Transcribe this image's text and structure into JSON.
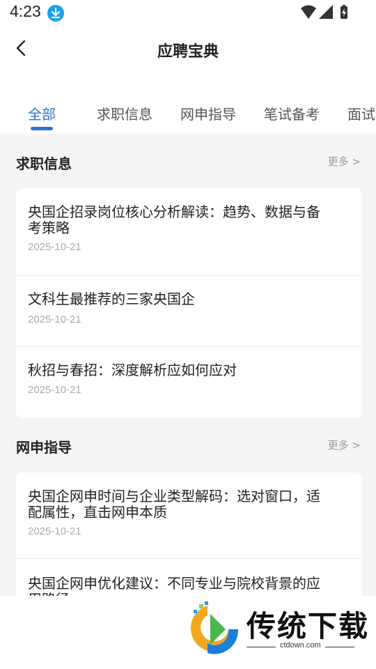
{
  "status_bar": {
    "time": "4:23"
  },
  "header": {
    "title": "应聘宝典"
  },
  "tabs": [
    {
      "label": "全部"
    },
    {
      "label": "求职信息"
    },
    {
      "label": "网申指导"
    },
    {
      "label": "笔试备考"
    },
    {
      "label": "面试"
    }
  ],
  "sections": [
    {
      "title": "求职信息",
      "more": "更多 >",
      "items": [
        {
          "title": "央国企招录岗位核心分析解读：趋势、数据与备考策略",
          "date": "2025-10-21"
        },
        {
          "title": "文科生最推荐的三家央国企",
          "date": "2025-10-21"
        },
        {
          "title": "秋招与春招：深度解析应如何应对",
          "date": "2025-10-21"
        }
      ]
    },
    {
      "title": "网申指导",
      "more": "更多 >",
      "items": [
        {
          "title": "央国企网申时间与企业类型解码：选对窗口，适配属性，直击网申本质",
          "date": "2025-10-21"
        },
        {
          "title": "央国企网申优化建议：不同专业与院校背景的应用路径"
        }
      ]
    }
  ],
  "watermark": {
    "text": "传统下载",
    "url": "ctdown.com"
  },
  "colors": {
    "accent": "#2a72d8",
    "background": "#f5f5f5"
  }
}
